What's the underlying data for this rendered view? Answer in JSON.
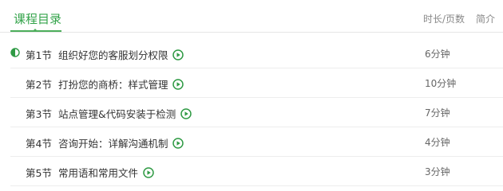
{
  "header": {
    "active_tab": "课程目录",
    "col_duration": "时长/页数",
    "col_intro": "简介"
  },
  "lessons": [
    {
      "num": "第1节",
      "title": "组织好您的客服划分权限",
      "duration": "6分钟",
      "status": "half"
    },
    {
      "num": "第2节",
      "title": "打扮您的商桥：样式管理",
      "duration": "10分钟",
      "status": "none"
    },
    {
      "num": "第3节",
      "title": "站点管理&代码安装于检测",
      "duration": "7分钟",
      "status": "none"
    },
    {
      "num": "第4节",
      "title": "咨询开始：详解沟通机制",
      "duration": "4分钟",
      "status": "none"
    },
    {
      "num": "第5节",
      "title": "常用语和常用文件",
      "duration": "3分钟",
      "status": "none"
    }
  ],
  "colors": {
    "accent": "#33a34a",
    "play_icon": "#2f9a44",
    "text": "#333333",
    "muted": "#888888"
  },
  "icons": {
    "status": "half-circle-progress-icon",
    "play": "play-circle-icon"
  }
}
